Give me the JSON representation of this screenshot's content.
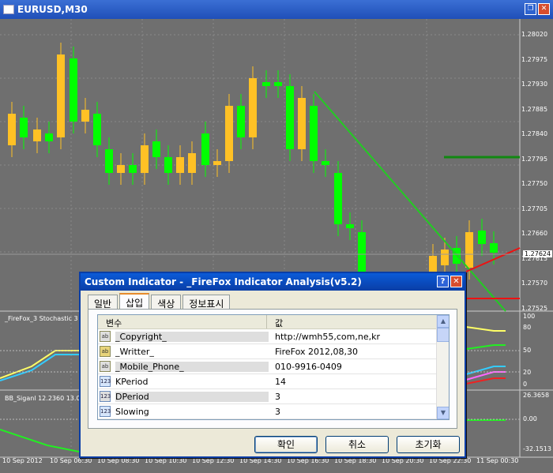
{
  "window": {
    "title": "EURUSD,M30"
  },
  "price_axis": [
    "1.28020",
    "1.27975",
    "1.27930",
    "1.27885",
    "1.27840",
    "1.27795",
    "1.27750",
    "1.27705",
    "1.27660",
    "1.27615",
    "1.27570",
    "1.27525"
  ],
  "current_price": "1.27624",
  "stoch": {
    "label": "_FireFox_3 Stochastic 3",
    "levels": [
      "100",
      "80",
      "50",
      "20",
      "0"
    ]
  },
  "bb": {
    "label": "BB_Siganl 12.2360 13.0",
    "levels": [
      "26.3658",
      "0.00",
      "-32.1513"
    ]
  },
  "time_axis": [
    "10 Sep 2012",
    "10 Sep 06:30",
    "10 Sep 08:30",
    "10 Sep 10:30",
    "10 Sep 12:30",
    "10 Sep 14:30",
    "10 Sep 16:30",
    "10 Sep 18:30",
    "10 Sep 20:30",
    "10 Sep 22:30",
    "11 Sep 00:30"
  ],
  "dialog": {
    "title": "Custom Indicator - _FireFox Indicator Analysis(v5.2)",
    "tabs": [
      "일반",
      "삽입",
      "색상",
      "정보표시"
    ],
    "columns": [
      "변수",
      "값"
    ],
    "rows": [
      {
        "icon": "ab",
        "name": "_Copyright_",
        "value": "http://wmh55,com,ne,kr"
      },
      {
        "icon": "ab",
        "name": "_Writter_",
        "value": "FireFox 2012,08,30"
      },
      {
        "icon": "ab",
        "name": "_Mobile_Phone_",
        "value": "010-9916-0409"
      },
      {
        "icon": "123",
        "name": "KPeriod",
        "value": "14"
      },
      {
        "icon": "123",
        "name": "DPeriod",
        "value": "3"
      },
      {
        "icon": "123",
        "name": "Slowing",
        "value": "3"
      }
    ],
    "buttons": {
      "ok": "확인",
      "cancel": "취소",
      "reset": "초기화"
    }
  },
  "colors": {
    "bull": "#00ff00",
    "bear": "#ffc125",
    "trend": "#22cc22",
    "red": "#ee1111"
  }
}
